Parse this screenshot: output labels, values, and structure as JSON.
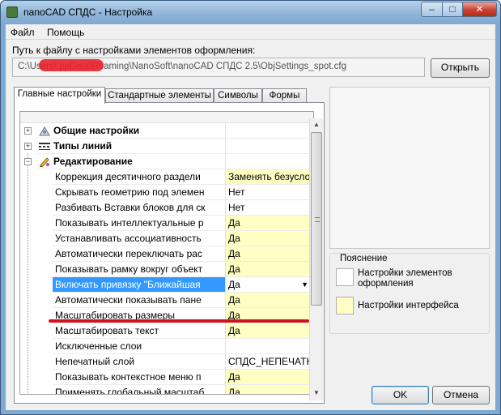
{
  "window": {
    "title": "nanoCAD СПДС - Настройка",
    "minimize_label": "–",
    "maximize_label": "□",
    "close_label": "✕"
  },
  "menu": {
    "items": [
      {
        "label": "Файл"
      },
      {
        "label": "Помощь"
      }
    ]
  },
  "path": {
    "label": "Путь к файлу с настройками элементов оформления:",
    "value": "C:\\Users\\          ppData\\Roaming\\NanoSoft\\nanoCAD СПДС 2.5\\ObjSettings_spot.cfg",
    "open_button": "Открыть"
  },
  "tabs": [
    {
      "label": "Главные настройки",
      "active": true
    },
    {
      "label": "Стандартные элементы"
    },
    {
      "label": "Символы"
    },
    {
      "label": "Формы"
    }
  ],
  "groups": [
    {
      "label": "Общие настройки",
      "expander": "+",
      "icon": "general-settings-icon"
    },
    {
      "label": "Типы линий",
      "expander": "+",
      "icon": "line-types-icon"
    },
    {
      "label": "Редактирование",
      "expander": "−",
      "icon": "editing-icon"
    }
  ],
  "rows": [
    {
      "name": "Коррекция десятичного раздели",
      "value": "Заменять безусло",
      "interface": true
    },
    {
      "name": "Скрывать геометрию под элемен",
      "value": "Нет",
      "interface": false
    },
    {
      "name": "Разбивать Вставки блоков для ск",
      "value": "Нет",
      "interface": false
    },
    {
      "name": "Показывать интеллектуальные р",
      "value": "Да",
      "interface": true
    },
    {
      "name": "Устанавливать ассоциативность",
      "value": "Да",
      "interface": true
    },
    {
      "name": "Автоматически переключать рас",
      "value": "Да",
      "interface": true
    },
    {
      "name": "Показывать рамку вокруг объект",
      "value": "Да",
      "interface": true
    },
    {
      "name": "Включать привязку \"Ближайшая",
      "value": "Да",
      "interface": true,
      "selected": true
    },
    {
      "name": "Автоматически показывать пане",
      "value": "Да",
      "interface": true
    },
    {
      "name": "Масштабировать размеры",
      "value": "Да",
      "interface": true
    },
    {
      "name": "Масштабировать текст",
      "value": "Да",
      "interface": true
    },
    {
      "name": "Исключенные слои",
      "value": "",
      "interface": false
    },
    {
      "name": "Непечатный слой",
      "value": "СПДС_НЕПЕЧАТН",
      "interface": false
    },
    {
      "name": "Показывать контекстное меню п",
      "value": "Да",
      "interface": true
    },
    {
      "name": "Применять глобальный масштаб",
      "value": "Да",
      "interface": true
    }
  ],
  "legend": {
    "title": "Пояснение",
    "element_settings": "Настройки элементов оформления",
    "interface_settings": "Настройки интерфейса",
    "element_color": "#ffffff",
    "interface_color": "#ffffc4"
  },
  "buttons": {
    "ok": "OK",
    "cancel": "Отмена"
  },
  "colors": {
    "selection": "#3399ff",
    "annotation_line": "#d0141e"
  }
}
